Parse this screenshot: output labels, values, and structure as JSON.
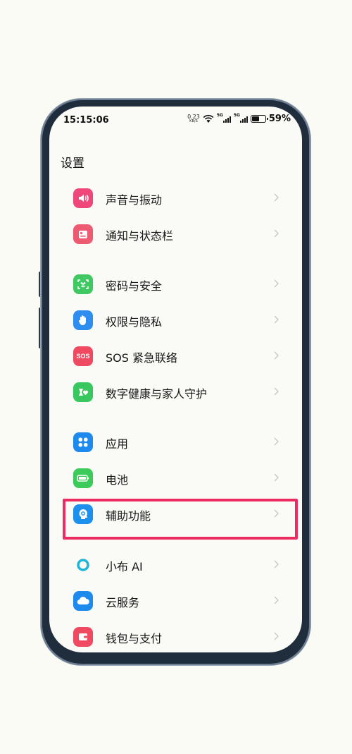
{
  "status_bar": {
    "time": "15:15:06",
    "net_speed": "0.23",
    "net_unit": "KB/S",
    "sim1_type": "5G",
    "sim2_type": "5G",
    "battery_percent": "59%",
    "battery_level": 0.59
  },
  "page": {
    "title": "设置"
  },
  "groups": [
    {
      "items": [
        {
          "label": "声音与振动",
          "icon": "speaker-icon",
          "color": "#f0477a"
        },
        {
          "label": "通知与状态栏",
          "icon": "notification-icon",
          "color": "#ef5a73"
        }
      ]
    },
    {
      "items": [
        {
          "label": "密码与安全",
          "icon": "face-lock-icon",
          "color": "#40c862"
        },
        {
          "label": "权限与隐私",
          "icon": "hand-icon",
          "color": "#2f8df0"
        },
        {
          "label": "SOS 紧急联络",
          "icon": "sos-icon",
          "color": "#ef4a62",
          "icon_text": "SOS"
        },
        {
          "label": "数字健康与家人守护",
          "icon": "heart-hourglass-icon",
          "color": "#39c860"
        }
      ]
    },
    {
      "items": [
        {
          "label": "应用",
          "icon": "apps-grid-icon",
          "color": "#1f8aed"
        },
        {
          "label": "电池",
          "icon": "battery-icon",
          "color": "#3ccb5a"
        },
        {
          "label": "辅助功能",
          "icon": "accessibility-head-icon",
          "color": "#1d8fec"
        }
      ]
    },
    {
      "items": [
        {
          "label": "小布 AI",
          "icon": "breeno-ring-icon",
          "color": "#1fb5d8"
        },
        {
          "label": "云服务",
          "icon": "cloud-icon",
          "color": "#1f8aed"
        },
        {
          "label": "钱包与支付",
          "icon": "wallet-icon",
          "color": "#ef4a62"
        }
      ]
    }
  ],
  "annotation": {
    "highlight_color": "#ea2c63",
    "highlighted_item": "辅助功能"
  }
}
